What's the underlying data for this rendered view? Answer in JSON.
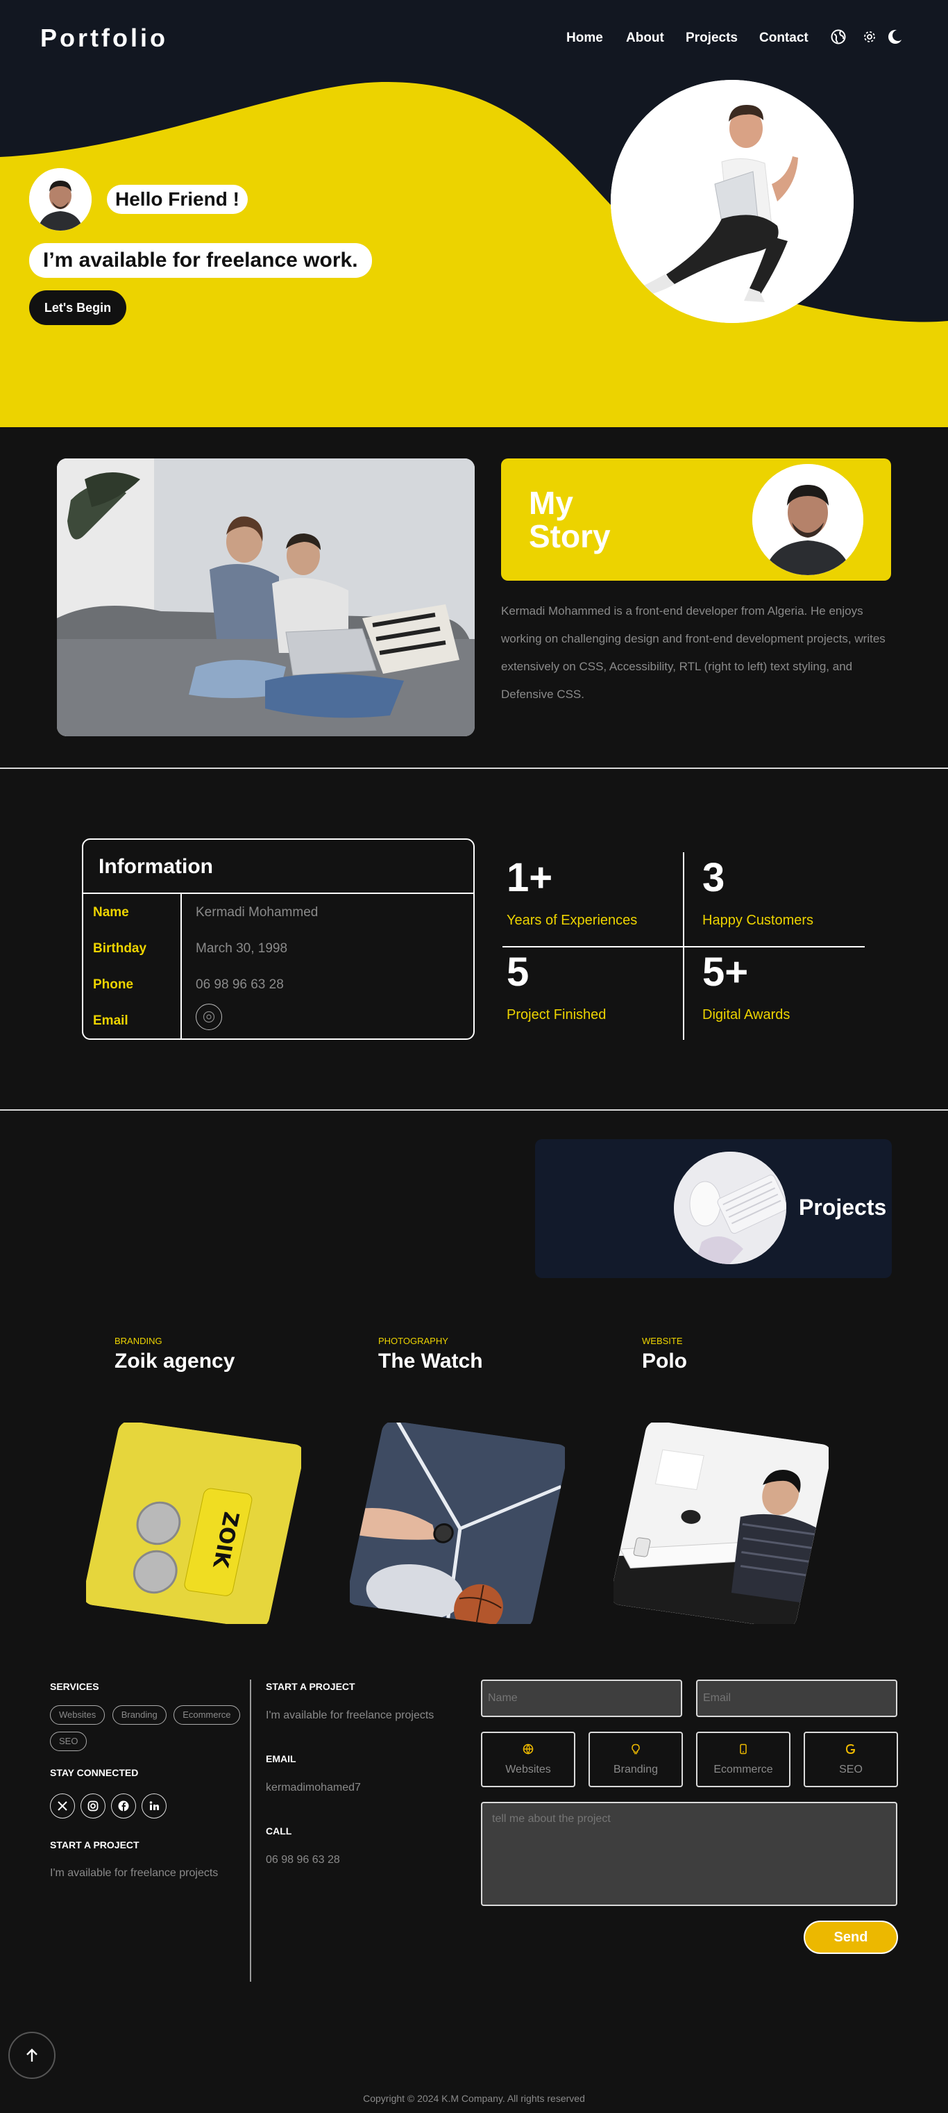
{
  "nav": {
    "logo": "Portfolio",
    "links": [
      "Home",
      "About",
      "Projects",
      "Contact"
    ],
    "icons": [
      "globe-icon",
      "gear-icon",
      "moon-icon"
    ]
  },
  "hero": {
    "greeting": "Hello Friend !",
    "availability": "I’m available for freelance work.",
    "cta": "Let's Begin"
  },
  "story": {
    "title_line1": "My",
    "title_line2": "Story",
    "text": "Kermadi Mohammed is a front-end developer from Algeria. He enjoys working on challenging design and front-end development projects, writes extensively on CSS, Accessibility, RTL (right to left) text styling, and Defensive CSS."
  },
  "info": {
    "heading": "Information",
    "rows": [
      {
        "key": "Name",
        "value": "Kermadi Mohammed"
      },
      {
        "key": "Birthday",
        "value": "March 30, 1998"
      },
      {
        "key": "Phone",
        "value": "06 98 96 63 28"
      },
      {
        "key": "Email",
        "value": ""
      }
    ]
  },
  "stats": [
    {
      "number": "1+",
      "label": "Years of Experiences"
    },
    {
      "number": "3",
      "label": "Happy Customers"
    },
    {
      "number": "5",
      "label": "Project Finished"
    },
    {
      "number": "5+",
      "label": "Digital Awards"
    }
  ],
  "projects": {
    "title": "Projects",
    "cards": [
      {
        "category": "BRANDING",
        "title": "Zoik agency"
      },
      {
        "category": "PHOTOGRAPHY",
        "title": "The Watch"
      },
      {
        "category": "WEBSITE",
        "title": "Polo"
      }
    ]
  },
  "footer": {
    "services_heading": "SERVICES",
    "services": [
      "Websites",
      "Branding",
      "Ecommerce",
      "SEO"
    ],
    "stay_heading": "STAY CONNECTED",
    "social_icons": [
      "x-icon",
      "instagram-icon",
      "facebook-icon",
      "linkedin-icon"
    ],
    "start_heading": "START A PROJECT",
    "start_text": "I'm available for freelance projects",
    "col2_start_heading": "START A PROJECT",
    "col2_start_text": "I'm available for freelance projects",
    "email_heading": "EMAIL",
    "email_value": "kermadimohamed7",
    "call_heading": "CALL",
    "call_value": "06 98 96 63 28"
  },
  "form": {
    "name_placeholder": "Name",
    "email_placeholder": "Email",
    "services": [
      {
        "label": "Websites",
        "icon": "globe-icon"
      },
      {
        "label": "Branding",
        "icon": "lightbulb-icon"
      },
      {
        "label": "Ecommerce",
        "icon": "mobile-icon"
      },
      {
        "label": "SEO",
        "icon": "google-icon"
      }
    ],
    "message_placeholder": "tell me about the project",
    "send": "Send"
  },
  "copyright": "Copyright © 2024 K.M Company. All rights reserved",
  "colors": {
    "accent": "#ecd300",
    "dark": "#121212",
    "navy": "#121a2b",
    "send": "#ecb800"
  }
}
